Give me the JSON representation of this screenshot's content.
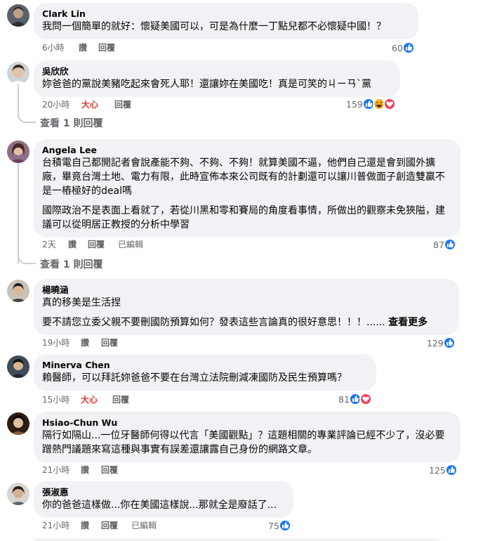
{
  "comments": [
    {
      "author": "Clark Lin",
      "paragraphs": [
        "我問一個簡單的就好：懷疑美國可以，可是為什麼一丁點兒都不必懷疑中國！？"
      ],
      "time": "6小時",
      "like_label": "讚",
      "reply_label": "回覆",
      "reaction_count": "60",
      "reactions": [
        "like-icon"
      ]
    },
    {
      "author": "吳欣欣",
      "paragraphs": [
        "妳爸爸的黨說美豬吃起來會死人耶！還讓妳在美國吃！真是可笑的ㄐㄧㄢˋ黨"
      ],
      "time": "20小時",
      "like_label": "大心",
      "reply_label": "回覆",
      "reaction_count": "159",
      "reactions": [
        "like-icon",
        "haha-icon",
        "love-icon"
      ],
      "view_replies": "查看 1 則回覆"
    },
    {
      "author": "Angela Lee",
      "paragraphs": [
        "台積電自己都開記者會說產能不夠、不夠、不夠！就算美國不逼，他們自己還是會到國外擴廠，畢竟台灣土地、電力有限，此時宣佈本來公司既有的計劃還可以讓川普做面子創造雙贏不是一樁極好的deal嗎",
        "國際政治不是表面上看就了，若從川黑和零和賽局的角度看事情，所做出的觀察未免狹隘，建議可以從明居正教授的分析中學習"
      ],
      "time": "2天",
      "like_label": "讚",
      "reply_label": "回覆",
      "edited_label": "已編輯",
      "reaction_count": "87",
      "reactions": [
        "like-icon"
      ],
      "view_replies": "查看 1 則回覆"
    },
    {
      "author": "楊曉涵",
      "paragraphs": [
        "真的移美是生活捏",
        "要不請您立委父親不要刪國防預算如何？發表這些言論真的很好意思！！！......"
      ],
      "see_more": "查看更多",
      "time": "19小時",
      "like_label": "讚",
      "reply_label": "回覆",
      "reaction_count": "129",
      "reactions": [
        "like-icon"
      ]
    },
    {
      "author": "Minerva Chen",
      "paragraphs": [
        "賴醫師，可以拜託妳爸爸不要在台灣立法院刪減凍國防及民生預算嗎？"
      ],
      "time": "15小時",
      "like_label": "大心",
      "reply_label": "回覆",
      "reaction_count": "81",
      "reactions": [
        "like-icon",
        "love-icon"
      ]
    },
    {
      "author": "Hsiao-Chun Wu",
      "paragraphs": [
        "隔行如隔山...一位牙醫師何得以代言「美國觀點」？這題相關的專業評論已經不少了，沒必要蹭熱門議題來寫這種與事實有誤差還讓露自己身份的網路文章。"
      ],
      "time": "21小時",
      "like_label": "讚",
      "reply_label": "回覆",
      "reaction_count": "125",
      "reactions": [
        "like-icon"
      ]
    },
    {
      "author": "張淑惠",
      "paragraphs": [
        "你的爸爸這樣做...你在美國這樣說...那就全是廢話了..."
      ],
      "time": "21小時",
      "like_label": "讚",
      "reply_label": "回覆",
      "edited_label": "已編輯",
      "reaction_count": "75",
      "reactions": [
        "like-icon"
      ]
    }
  ],
  "colors": {
    "bubble": "#f0f2f5",
    "meta": "#65676b",
    "liked": "#e03c2f",
    "like_blue": "#1877f2",
    "love_red": "#f33e58",
    "haha_yellow": "#f7b125"
  }
}
